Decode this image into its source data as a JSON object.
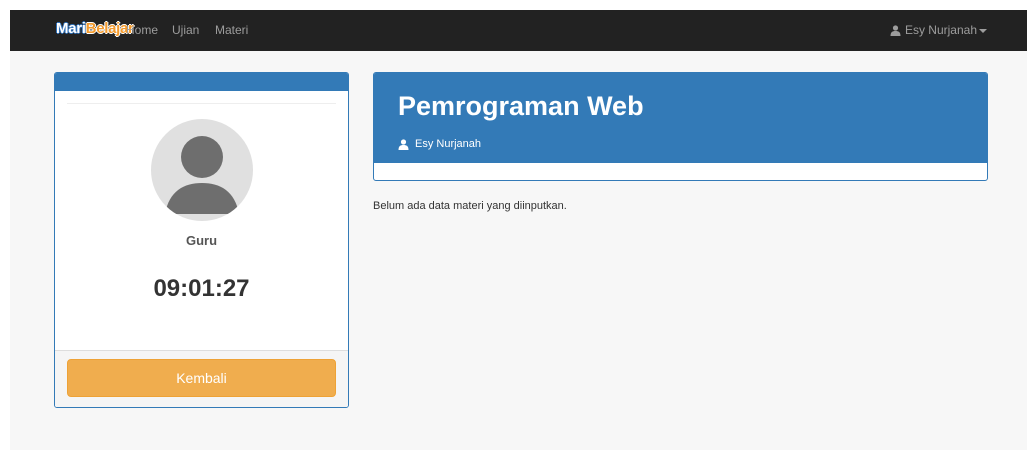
{
  "navbar": {
    "brand_part1": "Mari",
    "brand_part2": "Belajar",
    "links": [
      "Home",
      "Ujian",
      "Materi"
    ],
    "user_name": "Esy Nurjanah",
    "user_icon": "user-icon"
  },
  "profile": {
    "avatar_icon": "avatar-placeholder-icon",
    "role": "Guru",
    "clock": "09:01:27",
    "back_label": "Kembali"
  },
  "course": {
    "title": "Pemrograman Web",
    "teacher": "Esy Nurjanah",
    "teacher_icon": "user-icon",
    "empty_message": "Belum ada data materi yang diinputkan."
  },
  "colors": {
    "navbar": "#222222",
    "primary": "#337ab7",
    "warning": "#f0ad4e",
    "page_bg": "#f7f7f7"
  }
}
